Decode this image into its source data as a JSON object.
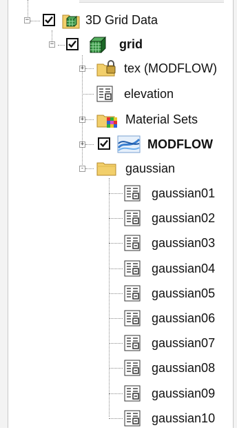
{
  "tree": {
    "root": {
      "label": "3D Grid Data",
      "checked": true,
      "expanded": true,
      "icon": "grid-data-folder-icon"
    },
    "grid": {
      "label": "grid",
      "checked": true,
      "expanded": true,
      "icon": "3d-grid-icon"
    },
    "children": [
      {
        "label": "tex (MODFLOW)",
        "icon": "locked-folder-icon",
        "expander": "+"
      },
      {
        "label": "elevation",
        "icon": "dataset-icon",
        "expander": ""
      },
      {
        "label": "Material Sets",
        "icon": "material-sets-folder-icon",
        "expander": "+"
      },
      {
        "label": "MODFLOW",
        "icon": "modflow-icon",
        "expander": "+",
        "checked": true
      },
      {
        "label": "gaussian",
        "icon": "folder-icon",
        "expander": "-"
      }
    ],
    "gaussian_items": [
      {
        "label": "gaussian01"
      },
      {
        "label": "gaussian02"
      },
      {
        "label": "gaussian03"
      },
      {
        "label": "gaussian04"
      },
      {
        "label": "gaussian05"
      },
      {
        "label": "gaussian06"
      },
      {
        "label": "gaussian07"
      },
      {
        "label": "gaussian08"
      },
      {
        "label": "gaussian09"
      },
      {
        "label": "gaussian10"
      }
    ]
  },
  "colors": {
    "folder": "#f2cf6b",
    "folder_dark": "#c9a13e",
    "grid_green": "#2d8a3a",
    "modflow_blue": "#3a7fd0"
  }
}
